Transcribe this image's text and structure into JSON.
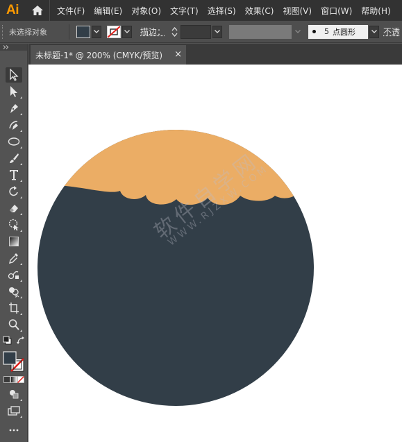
{
  "app": {
    "logo": "Ai"
  },
  "menubar": {
    "items": [
      "文件(F)",
      "编辑(E)",
      "对象(O)",
      "文字(T)",
      "选择(S)",
      "效果(C)",
      "视图(V)",
      "窗口(W)",
      "帮助(H)"
    ]
  },
  "controlbar": {
    "selection_status": "未选择对象",
    "stroke_label": "描边：",
    "brush_size": "5",
    "brush_label": "点圆形",
    "opacity_label": "不透"
  },
  "document": {
    "tab_title": "未标题-1* @ 200% (CMYK/预览)",
    "close_glyph": "×"
  },
  "colors": {
    "fill": "#323e48",
    "planet_body": "#323e48",
    "planet_cap": "#ebad65",
    "app_accent": "#ff9a00"
  },
  "watermark": {
    "text": "软件自学网",
    "url": "WWW.RJZXW.COM"
  },
  "tools": [
    "selection-tool-icon",
    "direct-selection-tool-icon",
    "pen-tool-icon",
    "curvature-tool-icon",
    "ellipse-tool-icon",
    "paintbrush-tool-icon",
    "type-tool-icon",
    "rotate-tool-icon",
    "eraser-tool-icon",
    "puppet-warp-tool-icon",
    "gradient-tool-icon",
    "eyedropper-tool-icon",
    "blend-tool-icon",
    "shape-builder-tool-icon",
    "artboard-tool-icon",
    "zoom-tool-icon",
    "default-colors-icon",
    "swap-colors-icon",
    "fill-stroke-icon",
    "color-modes-icon",
    "draw-mode-icon",
    "screen-mode-icon",
    "more-tools-icon"
  ]
}
